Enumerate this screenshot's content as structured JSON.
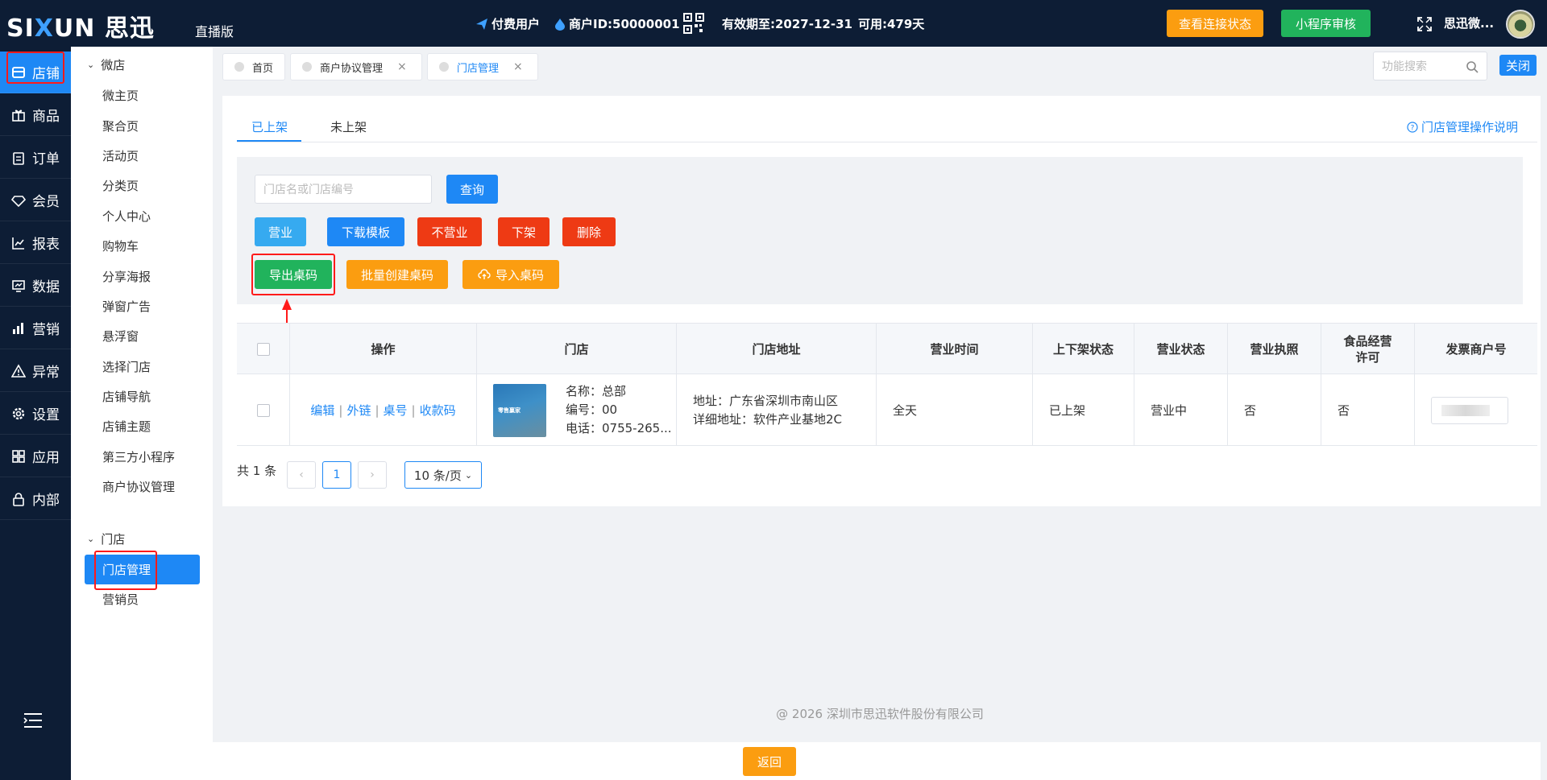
{
  "brand": {
    "logo_text_1": "SI",
    "logo_text_x": "X",
    "logo_text_2": "UN 思迅",
    "edition": "直播版"
  },
  "header": {
    "paid_user": "付费用户",
    "merchant_id": "商户ID:50000001",
    "valid_until": "有效期至:2027-12-31",
    "available": "可用:479天",
    "check_connection": "查看连接状态",
    "mini_program_review": "小程序审核",
    "user_name": "思迅微..."
  },
  "rail": {
    "items": [
      {
        "label": "店铺",
        "icon": "store-icon"
      },
      {
        "label": "商品",
        "icon": "gift-icon"
      },
      {
        "label": "订单",
        "icon": "clipboard-icon"
      },
      {
        "label": "会员",
        "icon": "diamond-icon"
      },
      {
        "label": "报表",
        "icon": "report-icon"
      },
      {
        "label": "数据",
        "icon": "chart-icon"
      },
      {
        "label": "营销",
        "icon": "bar-icon"
      },
      {
        "label": "异常",
        "icon": "warning-icon"
      },
      {
        "label": "设置",
        "icon": "gear-icon"
      },
      {
        "label": "应用",
        "icon": "apps-icon"
      },
      {
        "label": "内部",
        "icon": "lock-icon"
      }
    ]
  },
  "submenu": {
    "group1": "微店",
    "group1_items": [
      "微主页",
      "聚合页",
      "活动页",
      "分类页",
      "个人中心",
      "购物车",
      "分享海报",
      "弹窗广告",
      "悬浮窗",
      "选择门店",
      "店铺导航",
      "店铺主题",
      "第三方小程序",
      "商户协议管理"
    ],
    "group2": "门店",
    "group2_items": [
      "门店管理",
      "营销员"
    ]
  },
  "tabs": [
    {
      "label": "首页"
    },
    {
      "label": "商户协议管理",
      "close": "×"
    },
    {
      "label": "门店管理",
      "close": "×"
    }
  ],
  "func_search": {
    "placeholder": "功能搜索"
  },
  "close_button": "关闭",
  "panel": {
    "tab_on": "已上架",
    "tab_off": "未上架",
    "help": "门店管理操作说明",
    "search_placeholder": "门店名或门店编号",
    "query": "查询",
    "btn_open": "营业",
    "btn_download": "下载模板",
    "btn_closed": "不营业",
    "btn_unshelve": "下架",
    "btn_delete": "删除",
    "btn_export": "导出桌码",
    "btn_batch": "批量创建桌码",
    "btn_import": "导入桌码"
  },
  "table": {
    "headers": [
      "操作",
      "门店",
      "门店地址",
      "营业时间",
      "上下架状态",
      "营业状态",
      "营业执照",
      "食品经营许可",
      "发票商户号"
    ],
    "row": {
      "ops": [
        "编辑",
        "外链",
        "桌号",
        "收款码"
      ],
      "thumb_text": "零售赢家",
      "name": "名称：总部",
      "code": "编号：00",
      "phone": "电话：0755-265...",
      "address": "地址：广东省深圳市南山区",
      "address_detail": "详细地址：软件产业基地2C",
      "hours": "全天",
      "shelf_status": "已上架",
      "business_status": "营业中",
      "license": "否",
      "food_license": "否"
    }
  },
  "pager": {
    "total": "共 1 条",
    "prev": "‹",
    "page": "1",
    "next": "›",
    "page_size": "10 条/页"
  },
  "footer": "@ 2026 深圳市思迅软件股份有限公司",
  "back": "返回",
  "colors": {
    "primary": "#1e88f5",
    "dark": "#0d1d35",
    "highlight": "#ff1a1a"
  }
}
